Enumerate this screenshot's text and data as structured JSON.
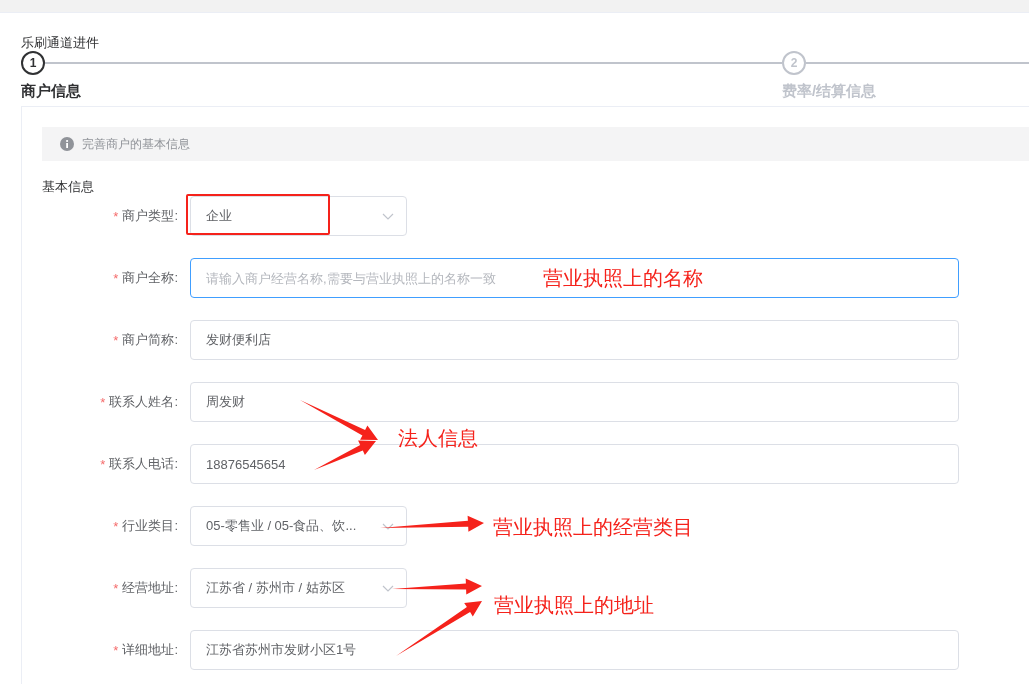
{
  "header": {
    "title": "乐刷通道进件"
  },
  "steps": [
    {
      "number": "1",
      "label": "商户信息",
      "selected": true
    },
    {
      "number": "2",
      "label": "费率/结算信息",
      "selected": false
    }
  ],
  "alert": {
    "text": "完善商户的基本信息"
  },
  "section_title": "基本信息",
  "fields": [
    {
      "label": "商户类型:",
      "required_mark": "*",
      "kind": "select",
      "value": "企业",
      "focused": false,
      "highlighted": true
    },
    {
      "label": "商户全称:",
      "required_mark": "*",
      "kind": "input",
      "placeholder": "请输入商户经营名称,需要与营业执照上的名称一致",
      "focused": true,
      "highlighted": false
    },
    {
      "label": "商户简称:",
      "required_mark": "*",
      "kind": "input",
      "value": "发财便利店",
      "focused": false,
      "highlighted": false
    },
    {
      "label": "联系人姓名:",
      "required_mark": "*",
      "kind": "input",
      "value": "周发财",
      "focused": false,
      "highlighted": false
    },
    {
      "label": "联系人电话:",
      "required_mark": "*",
      "kind": "input",
      "value": "18876545654",
      "focused": false,
      "highlighted": false
    },
    {
      "label": "行业类目:",
      "required_mark": "*",
      "kind": "select",
      "value": "05-零售业 / 05-食品、饮...",
      "focused": false,
      "highlighted": false
    },
    {
      "label": "经营地址:",
      "required_mark": "*",
      "kind": "select",
      "value": "江苏省 / 苏州市 / 姑苏区",
      "focused": false,
      "highlighted": false
    },
    {
      "label": "详细地址:",
      "required_mark": "*",
      "kind": "input",
      "value": "江苏省苏州市发财小区1号",
      "focused": false,
      "highlighted": false
    }
  ],
  "annotations": [
    {
      "text": "营业执照上的名称"
    },
    {
      "text": "法人信息"
    },
    {
      "text": "营业执照上的经营类目"
    },
    {
      "text": "营业执照上的地址"
    }
  ]
}
